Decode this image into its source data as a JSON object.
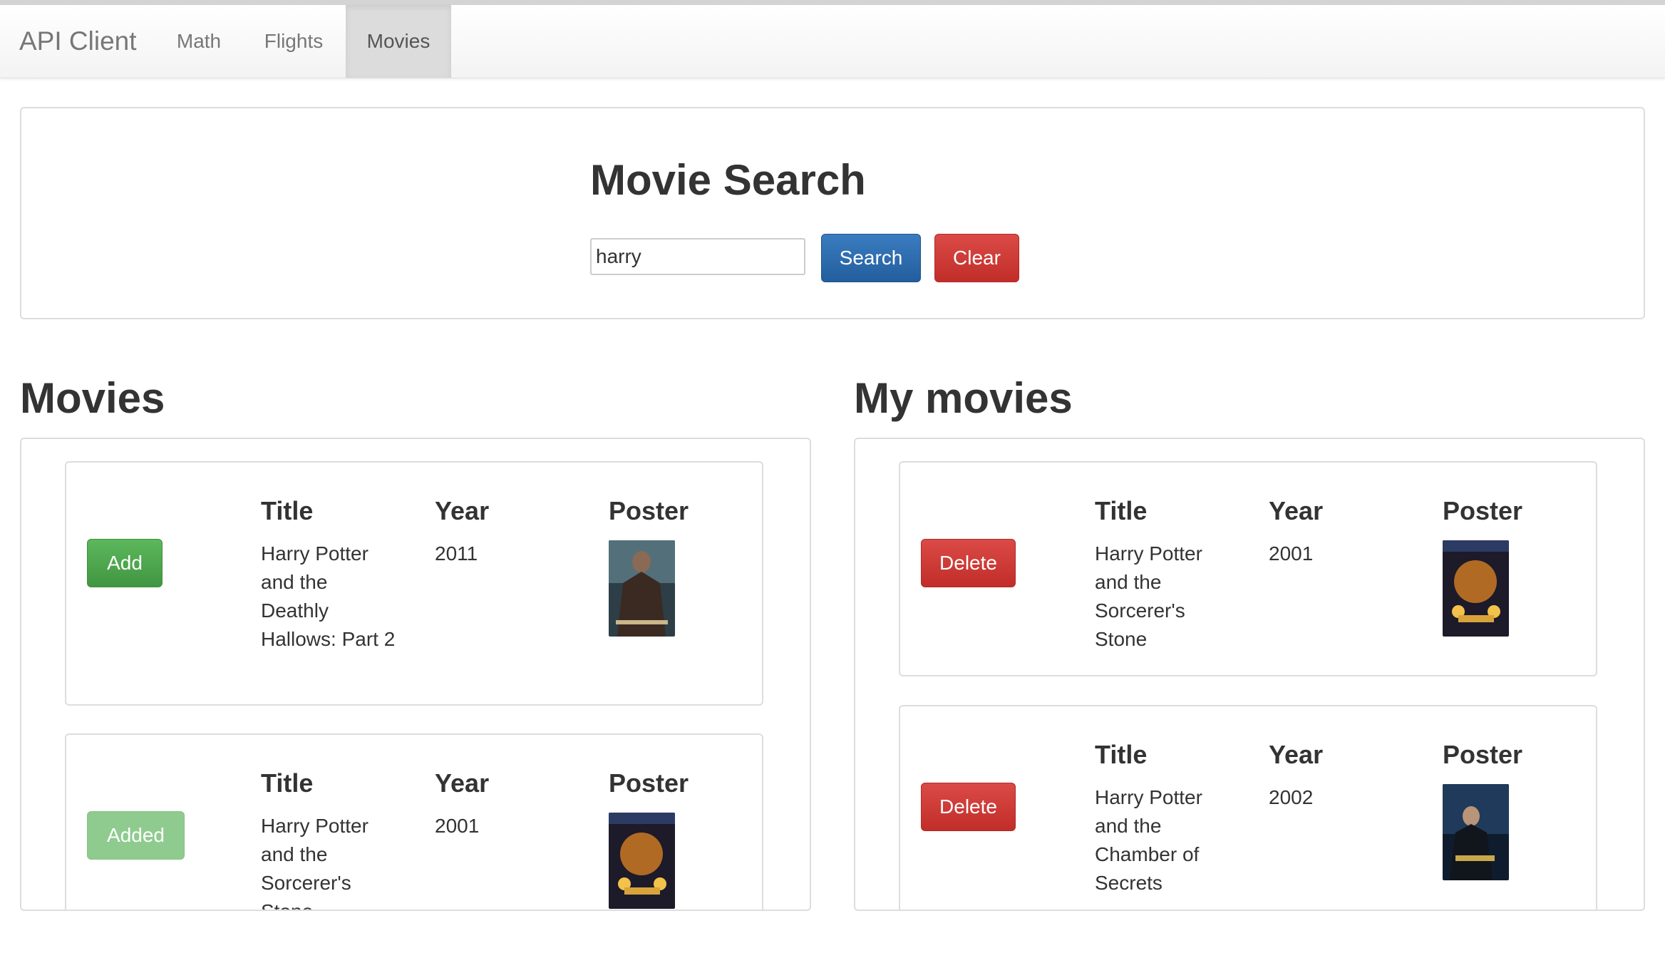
{
  "navbar": {
    "brand": "API Client",
    "links": [
      {
        "label": "Math",
        "active": false
      },
      {
        "label": "Flights",
        "active": false
      },
      {
        "label": "Movies",
        "active": true
      }
    ]
  },
  "search": {
    "title": "Movie Search",
    "query": "harry",
    "search_label": "Search",
    "clear_label": "Clear"
  },
  "movies": {
    "heading": "Movies",
    "columns": {
      "title": "Title",
      "year": "Year",
      "poster": "Poster"
    },
    "items": [
      {
        "action": "Add",
        "title": "Harry Potter and the Deathly Hallows: Part 2",
        "year": "2011",
        "poster": "Deathly Hallows Part 2 poster"
      },
      {
        "action": "Added",
        "title": "Harry Potter and the Sorcerer's Stone",
        "year": "2001",
        "poster": "Sorcerer's Stone poster"
      }
    ]
  },
  "my_movies": {
    "heading": "My movies",
    "columns": {
      "title": "Title",
      "year": "Year",
      "poster": "Poster"
    },
    "items": [
      {
        "action": "Delete",
        "title": "Harry Potter and the Sorcerer's Stone",
        "year": "2001",
        "poster": "Sorcerer's Stone poster"
      },
      {
        "action": "Delete",
        "title": "Harry Potter and the Chamber of Secrets",
        "year": "2002",
        "poster": "Chamber of Secrets poster"
      }
    ]
  },
  "colors": {
    "primary": "#286090",
    "danger": "#d9534f",
    "success": "#5cb85c",
    "success_disabled": "#8fcb8f"
  }
}
